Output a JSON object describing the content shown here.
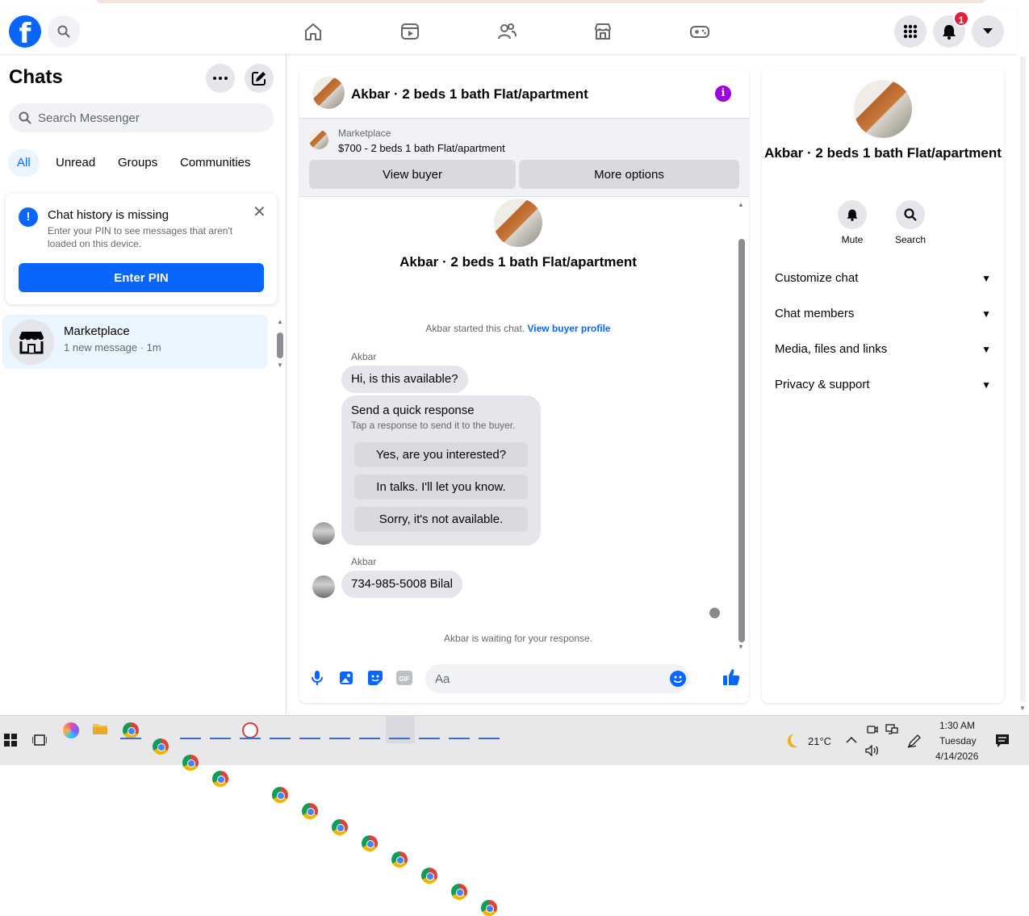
{
  "topbar": {
    "logo": "f",
    "nav_icons": [
      "home-icon",
      "video-icon",
      "friends-icon",
      "marketplace-icon",
      "gaming-icon"
    ],
    "notification_count": "1"
  },
  "left": {
    "title": "Chats",
    "search_placeholder": "Search Messenger",
    "filters": [
      "All",
      "Unread",
      "Groups",
      "Communities"
    ],
    "notice": {
      "title": "Chat history is missing",
      "desc": "Enter your PIN to see messages that aren't loaded on this device.",
      "button": "Enter PIN",
      "close": "✕"
    },
    "chat_item": {
      "name": "Marketplace",
      "sub": "1 new message · 1m"
    }
  },
  "conversation": {
    "title": "Akbar · 2 beds 1 bath Flat/apartment",
    "marketplace": {
      "label": "Marketplace",
      "listing": "$700 - 2 beds 1 bath Flat/apartment"
    },
    "buttons": {
      "view_buyer": "View buyer",
      "more_options": "More options"
    },
    "started_text": "Akbar started this chat. ",
    "started_link": "View buyer profile",
    "sender1": "Akbar",
    "msg1": "Hi, is this available?",
    "quick": {
      "title": "Send a quick response",
      "desc": "Tap a response to send it to the buyer.",
      "options": [
        "Yes, are you interested?",
        "In talks. I'll let you know.",
        "Sorry, it's not available."
      ]
    },
    "sender2": "Akbar",
    "msg2": "734-985-5008 Bilal",
    "waiting": "Akbar is waiting for your response.",
    "composer_placeholder": "Aa"
  },
  "right": {
    "name": "Akbar · 2 beds 1 bath Flat/apartment",
    "actions": [
      "Mute",
      "Search"
    ],
    "rows": [
      "Customize chat",
      "Chat members",
      "Media, files and links",
      "Privacy & support"
    ]
  },
  "taskbar": {
    "temp": "21°C",
    "time": "1:30 AM",
    "day": "Tuesday",
    "date": "4/14/2026"
  },
  "colors": {
    "brand": "#0866ff",
    "info": "#a100e0",
    "badge": "#e41e3f"
  }
}
